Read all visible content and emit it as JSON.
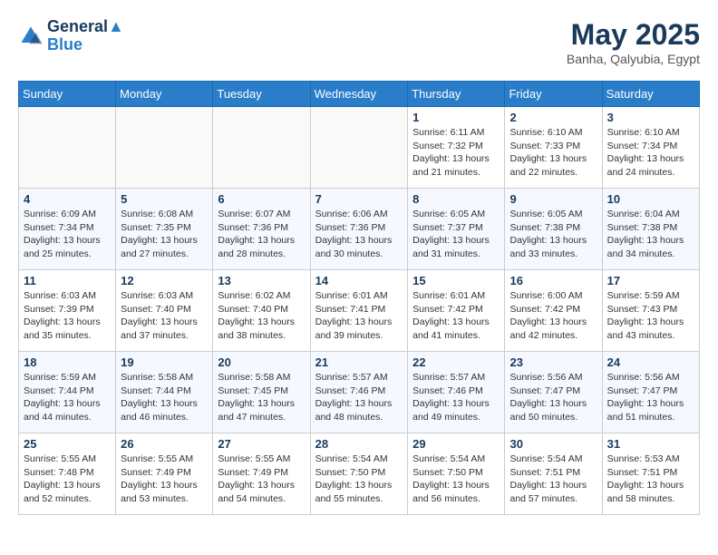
{
  "header": {
    "logo_line1": "General",
    "logo_line2": "Blue",
    "month_title": "May 2025",
    "subtitle": "Banha, Qalyubia, Egypt"
  },
  "weekdays": [
    "Sunday",
    "Monday",
    "Tuesday",
    "Wednesday",
    "Thursday",
    "Friday",
    "Saturday"
  ],
  "weeks": [
    [
      {
        "day": "",
        "info": ""
      },
      {
        "day": "",
        "info": ""
      },
      {
        "day": "",
        "info": ""
      },
      {
        "day": "",
        "info": ""
      },
      {
        "day": "1",
        "info": "Sunrise: 6:11 AM\nSunset: 7:32 PM\nDaylight: 13 hours\nand 21 minutes."
      },
      {
        "day": "2",
        "info": "Sunrise: 6:10 AM\nSunset: 7:33 PM\nDaylight: 13 hours\nand 22 minutes."
      },
      {
        "day": "3",
        "info": "Sunrise: 6:10 AM\nSunset: 7:34 PM\nDaylight: 13 hours\nand 24 minutes."
      }
    ],
    [
      {
        "day": "4",
        "info": "Sunrise: 6:09 AM\nSunset: 7:34 PM\nDaylight: 13 hours\nand 25 minutes."
      },
      {
        "day": "5",
        "info": "Sunrise: 6:08 AM\nSunset: 7:35 PM\nDaylight: 13 hours\nand 27 minutes."
      },
      {
        "day": "6",
        "info": "Sunrise: 6:07 AM\nSunset: 7:36 PM\nDaylight: 13 hours\nand 28 minutes."
      },
      {
        "day": "7",
        "info": "Sunrise: 6:06 AM\nSunset: 7:36 PM\nDaylight: 13 hours\nand 30 minutes."
      },
      {
        "day": "8",
        "info": "Sunrise: 6:05 AM\nSunset: 7:37 PM\nDaylight: 13 hours\nand 31 minutes."
      },
      {
        "day": "9",
        "info": "Sunrise: 6:05 AM\nSunset: 7:38 PM\nDaylight: 13 hours\nand 33 minutes."
      },
      {
        "day": "10",
        "info": "Sunrise: 6:04 AM\nSunset: 7:38 PM\nDaylight: 13 hours\nand 34 minutes."
      }
    ],
    [
      {
        "day": "11",
        "info": "Sunrise: 6:03 AM\nSunset: 7:39 PM\nDaylight: 13 hours\nand 35 minutes."
      },
      {
        "day": "12",
        "info": "Sunrise: 6:03 AM\nSunset: 7:40 PM\nDaylight: 13 hours\nand 37 minutes."
      },
      {
        "day": "13",
        "info": "Sunrise: 6:02 AM\nSunset: 7:40 PM\nDaylight: 13 hours\nand 38 minutes."
      },
      {
        "day": "14",
        "info": "Sunrise: 6:01 AM\nSunset: 7:41 PM\nDaylight: 13 hours\nand 39 minutes."
      },
      {
        "day": "15",
        "info": "Sunrise: 6:01 AM\nSunset: 7:42 PM\nDaylight: 13 hours\nand 41 minutes."
      },
      {
        "day": "16",
        "info": "Sunrise: 6:00 AM\nSunset: 7:42 PM\nDaylight: 13 hours\nand 42 minutes."
      },
      {
        "day": "17",
        "info": "Sunrise: 5:59 AM\nSunset: 7:43 PM\nDaylight: 13 hours\nand 43 minutes."
      }
    ],
    [
      {
        "day": "18",
        "info": "Sunrise: 5:59 AM\nSunset: 7:44 PM\nDaylight: 13 hours\nand 44 minutes."
      },
      {
        "day": "19",
        "info": "Sunrise: 5:58 AM\nSunset: 7:44 PM\nDaylight: 13 hours\nand 46 minutes."
      },
      {
        "day": "20",
        "info": "Sunrise: 5:58 AM\nSunset: 7:45 PM\nDaylight: 13 hours\nand 47 minutes."
      },
      {
        "day": "21",
        "info": "Sunrise: 5:57 AM\nSunset: 7:46 PM\nDaylight: 13 hours\nand 48 minutes."
      },
      {
        "day": "22",
        "info": "Sunrise: 5:57 AM\nSunset: 7:46 PM\nDaylight: 13 hours\nand 49 minutes."
      },
      {
        "day": "23",
        "info": "Sunrise: 5:56 AM\nSunset: 7:47 PM\nDaylight: 13 hours\nand 50 minutes."
      },
      {
        "day": "24",
        "info": "Sunrise: 5:56 AM\nSunset: 7:47 PM\nDaylight: 13 hours\nand 51 minutes."
      }
    ],
    [
      {
        "day": "25",
        "info": "Sunrise: 5:55 AM\nSunset: 7:48 PM\nDaylight: 13 hours\nand 52 minutes."
      },
      {
        "day": "26",
        "info": "Sunrise: 5:55 AM\nSunset: 7:49 PM\nDaylight: 13 hours\nand 53 minutes."
      },
      {
        "day": "27",
        "info": "Sunrise: 5:55 AM\nSunset: 7:49 PM\nDaylight: 13 hours\nand 54 minutes."
      },
      {
        "day": "28",
        "info": "Sunrise: 5:54 AM\nSunset: 7:50 PM\nDaylight: 13 hours\nand 55 minutes."
      },
      {
        "day": "29",
        "info": "Sunrise: 5:54 AM\nSunset: 7:50 PM\nDaylight: 13 hours\nand 56 minutes."
      },
      {
        "day": "30",
        "info": "Sunrise: 5:54 AM\nSunset: 7:51 PM\nDaylight: 13 hours\nand 57 minutes."
      },
      {
        "day": "31",
        "info": "Sunrise: 5:53 AM\nSunset: 7:51 PM\nDaylight: 13 hours\nand 58 minutes."
      }
    ]
  ]
}
